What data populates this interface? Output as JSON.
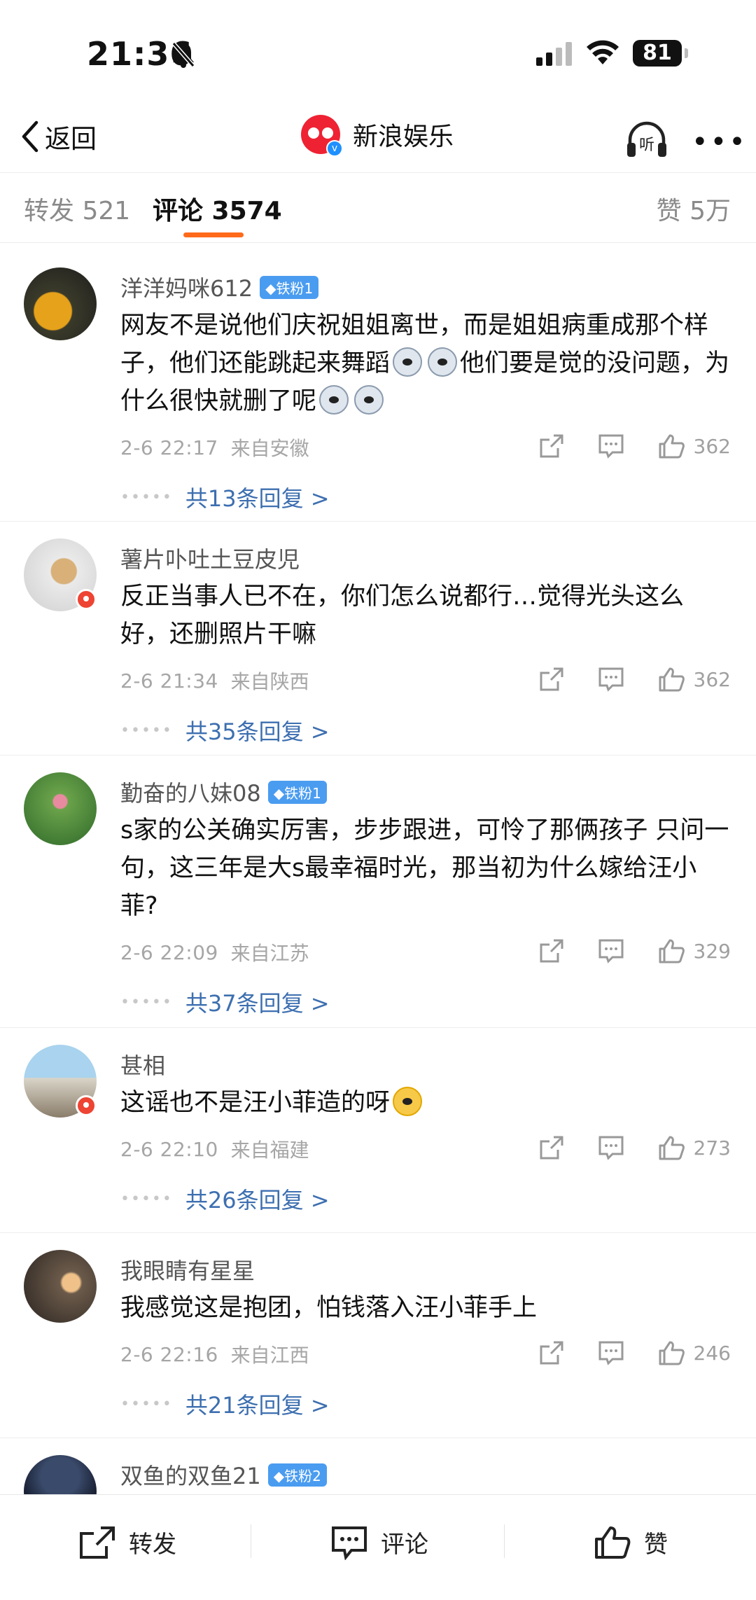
{
  "status": {
    "time": "21:36",
    "battery": "81"
  },
  "nav": {
    "back_label": "返回",
    "title": "新浪娱乐",
    "listen_label": "听"
  },
  "tabs": {
    "repost": "转发 521",
    "comment": "评论 3574",
    "like": "赞 5万"
  },
  "comments": [
    {
      "user": "洋洋妈咪612",
      "badge": "铁粉1",
      "text_parts": [
        "网友不是说他们庆祝姐姐离世，而是姐姐病重成那个样子，他们还能跳起来舞蹈",
        "他们要是觉的没问题，为什么很快就删了呢"
      ],
      "time": "2-6 22:17",
      "location": "来自安徽",
      "likes": "362",
      "replies": "共13条回复 >"
    },
    {
      "user": "薯片卟吐土豆皮児",
      "badge": "",
      "text": "反正当事人已不在，你们怎么说都行…觉得光头这么好，还删照片干嘛",
      "time": "2-6 21:34",
      "location": "来自陕西",
      "likes": "362",
      "replies": "共35条回复 >"
    },
    {
      "user": "勤奋的八妹08",
      "badge": "铁粉1",
      "text": "s家的公关确实厉害，步步跟进，可怜了那俩孩子 只问一句，这三年是大s最幸福时光，那当初为什么嫁给汪小菲?",
      "time": "2-6 22:09",
      "location": "来自江苏",
      "likes": "329",
      "replies": "共37条回复 >"
    },
    {
      "user": "甚相",
      "badge": "",
      "text": "这谣也不是汪小菲造的呀",
      "time": "2-6 22:10",
      "location": "来自福建",
      "likes": "273",
      "replies": "共26条回复 >"
    },
    {
      "user": "我眼睛有星星",
      "badge": "",
      "text": "我感觉这是抱团，怕钱落入汪小菲手上",
      "time": "2-6 22:16",
      "location": "来自江西",
      "likes": "246",
      "replies": "共21条回复 >"
    },
    {
      "user": "双鱼的双鱼21",
      "badge": "铁粉2"
    }
  ],
  "bottom": {
    "repost": "转发",
    "comment": "评论",
    "like": "赞"
  },
  "colors": {
    "accent": "#ff6a1a",
    "link": "#3d6fb0",
    "badge": "#4a9cf0"
  }
}
